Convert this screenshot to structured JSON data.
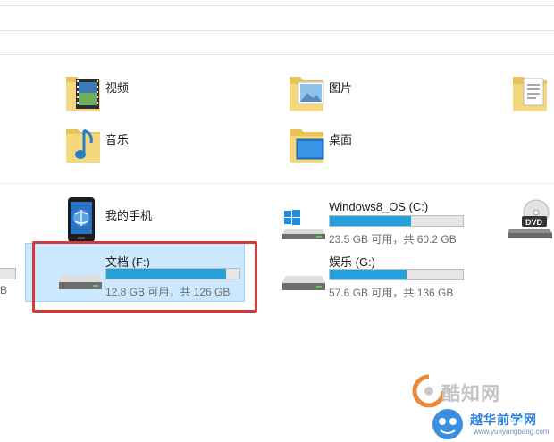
{
  "folders": [
    {
      "name": "视频",
      "icon": "video-folder-icon"
    },
    {
      "name": "图片",
      "icon": "pictures-folder-icon"
    },
    {
      "name": "音乐",
      "icon": "music-folder-icon"
    },
    {
      "name": "桌面",
      "icon": "desktop-folder-icon"
    }
  ],
  "devices": [
    {
      "name": "我的手机",
      "icon": "phone-icon"
    },
    {
      "name": "Windows8_OS (C:)",
      "free_text": "23.5 GB 可用，共 60.2 GB",
      "used_fraction": 0.61
    },
    {
      "name": "文档 (F:)",
      "free_text": "12.8 GB 可用，共 126 GB",
      "used_fraction": 0.9
    },
    {
      "name": "娱乐 (G:)",
      "free_text": "57.6 GB 可用，共 136 GB",
      "used_fraction": 0.58
    }
  ],
  "left_edge": {
    "text": "B"
  },
  "watermark": {
    "line1": "酷知网",
    "line2": "越华前学网",
    "line3": "www.yueyangbang.com"
  },
  "icons": [
    "document-folder-icon",
    "dvd-drive-icon",
    "windows-logo-icon",
    "hard-drive-icon"
  ],
  "colors": {
    "bar_fill": "#26a0da",
    "selection": "#cce8ff",
    "highlight_box": "#d33a3a"
  }
}
